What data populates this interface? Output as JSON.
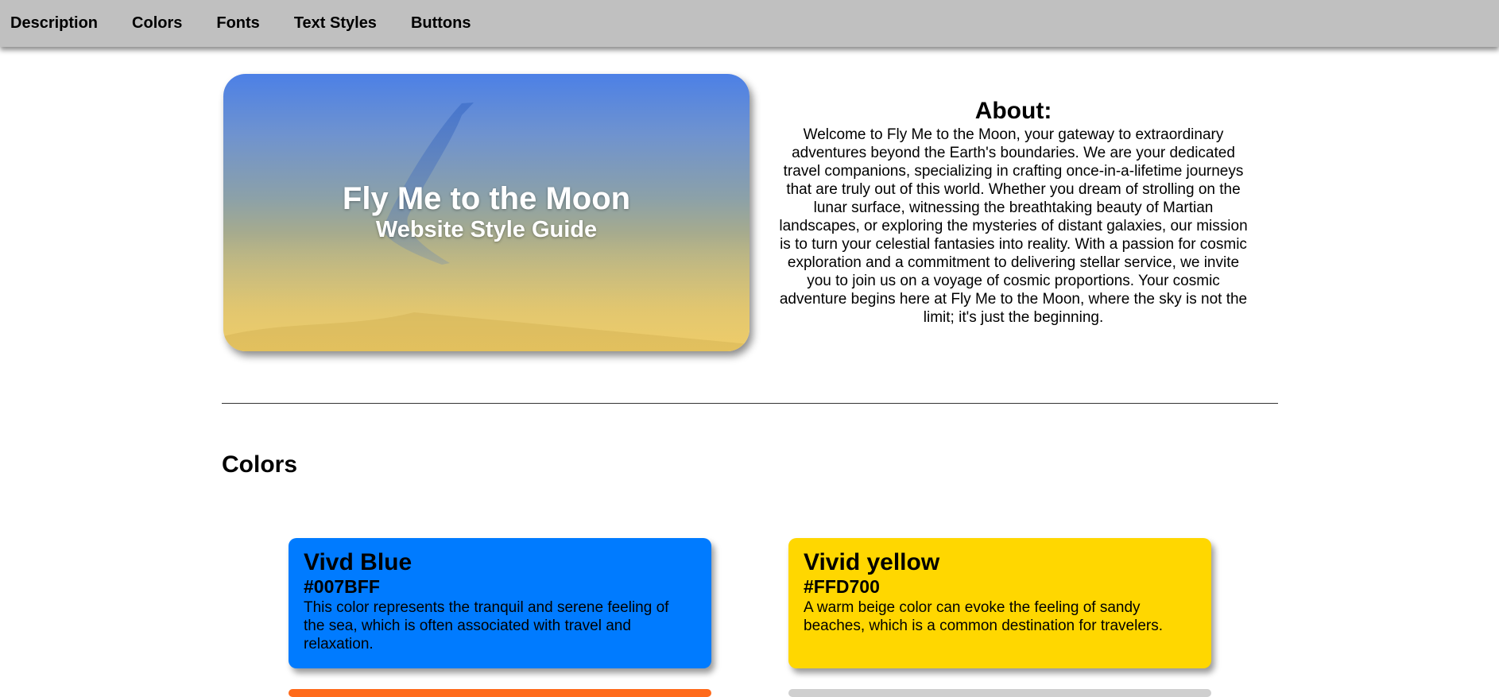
{
  "nav": {
    "items": [
      "Description",
      "Colors",
      "Fonts",
      "Text Styles",
      "Buttons"
    ]
  },
  "hero": {
    "title": "Fly Me to the Moon",
    "subtitle": "Website Style Guide"
  },
  "about": {
    "heading": "About:",
    "body": "Welcome to Fly Me to the Moon, your gateway to extraordinary adventures beyond the Earth's boundaries. We are your dedicated travel companions, specializing in crafting once-in-a-lifetime journeys that are truly out of this world. Whether you dream of strolling on the lunar surface, witnessing the breathtaking beauty of Martian landscapes, or exploring the mysteries of distant galaxies, our mission is to turn your celestial fantasies into reality. With a passion for cosmic exploration and a commitment to delivering stellar service, we invite you to join us on a voyage of cosmic proportions. Your cosmic adventure begins here at Fly Me to the Moon, where the sky is not the limit; it's just the beginning."
  },
  "colors_section": {
    "title": "Colors",
    "cards": [
      {
        "name": "Vivd Blue",
        "hex": "#007BFF",
        "description": "This color represents the tranquil and serene feeling of the sea, which is often associated with travel and relaxation."
      },
      {
        "name": "Vivid yellow",
        "hex": "#FFD700",
        "description": "A warm beige color can evoke the feeling of sandy beaches, which is a common destination for travelers."
      }
    ]
  },
  "theme": {
    "nav_bg": "#c0c0c0",
    "peek_orange": "#ff6a1a",
    "peek_gray": "#cfcfcf"
  }
}
